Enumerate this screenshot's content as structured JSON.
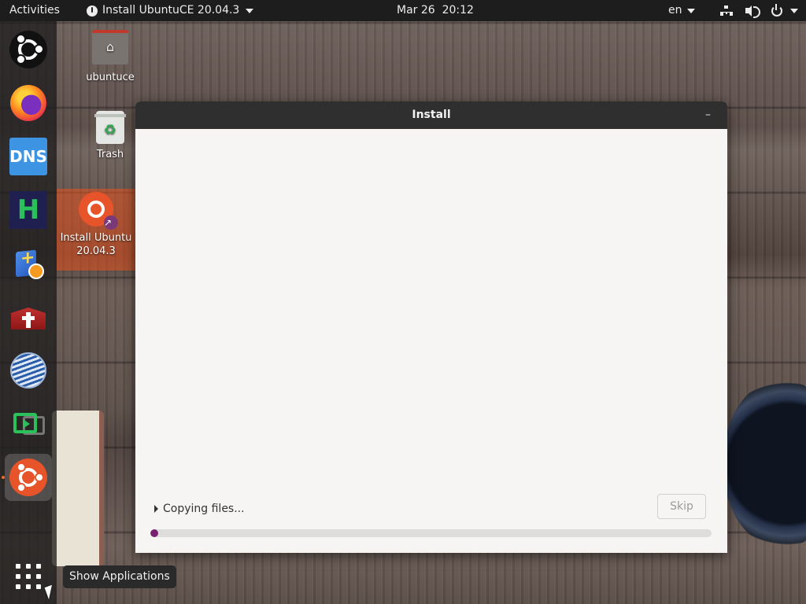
{
  "topbar": {
    "activities": "Activities",
    "app_menu": "Install UbuntuCE 20.04.3",
    "clock": "Mar 26  20:12",
    "language": "en"
  },
  "desktop": {
    "icons": [
      {
        "label": "ubuntuce"
      },
      {
        "label": "Trash"
      },
      {
        "label": "Install Ubuntu\n20.04.3"
      }
    ]
  },
  "dock": {
    "items": [
      "ubuntu-logo-icon",
      "firefox-icon",
      "dns-icon",
      "hexchat-icon",
      "bible-blue-icon",
      "bible-red-icon",
      "globe-icon",
      "media-icon",
      "ubuntu-installer-icon"
    ],
    "dns_text": "DNS",
    "h_text": "H",
    "show_apps_tooltip": "Show Applications"
  },
  "window": {
    "title": "Install",
    "minimize_symbol": "–",
    "status_text": "Copying files...",
    "skip_label": "Skip",
    "progress_fraction": 0.01
  },
  "colors": {
    "accent": "#77216f",
    "ubuntu_orange": "#e9541f",
    "topbar": "#1d1d1d"
  }
}
